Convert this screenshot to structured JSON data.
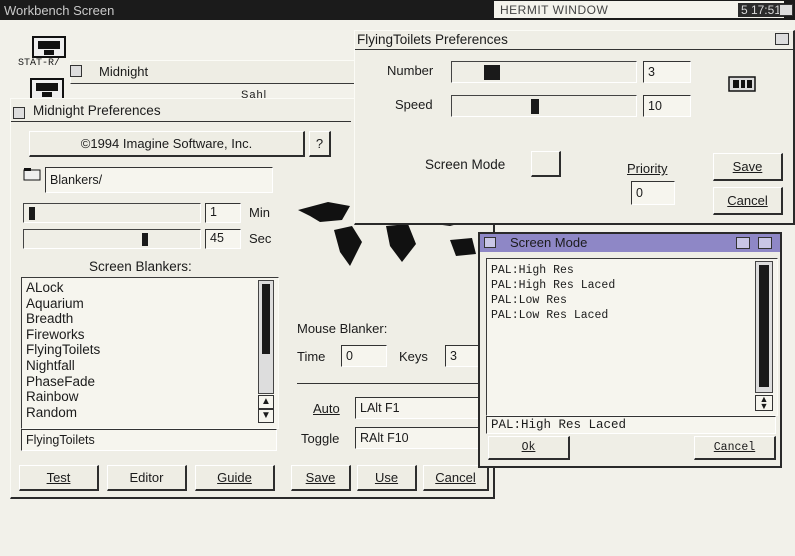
{
  "screen": {
    "title": "Workbench Screen",
    "hermit_title": "HERMIT WINDOW",
    "clock_fragment": "5 17:51"
  },
  "desktop_icons": [
    {
      "label": "STAT-R/"
    },
    {
      "label": "Midnight"
    }
  ],
  "midnight_window": {
    "title": "Midnight",
    "prefs_title": "Midnight Preferences",
    "copyright": "©1994 Imagine Software, Inc.",
    "help_label": "?",
    "blankers_path": "Blankers/",
    "min_value": "1",
    "min_label": "Min",
    "sec_value": "45",
    "sec_label": "Sec",
    "min_level": 0.02,
    "sec_level": 0.7,
    "screen_blankers_label": "Screen Blankers:",
    "blankers": [
      "ALock",
      "Aquarium",
      "Breadth",
      "Fireworks",
      "FlyingToilets",
      "Nightfall",
      "PhaseFade",
      "Rainbow",
      "Random"
    ],
    "selected_blanker": "FlyingToilets",
    "mouse_blanker_label": "Mouse Blanker:",
    "time_label": "Time",
    "time_value": "0",
    "keys_label": "Keys",
    "keys_value": "3",
    "auto_label": "Auto",
    "auto_value": "LAlt F1",
    "toggle_label": "Toggle",
    "toggle_value": "RAlt F10",
    "buttons": {
      "test": "Test",
      "editor": "Editor",
      "guide": "Guide",
      "save": "Save",
      "use": "Use",
      "cancel": "Cancel"
    }
  },
  "flying_toilets_prefs": {
    "title": "FlyingToilets Preferences",
    "number_label": "Number",
    "number_value": "3",
    "number_level": 0.18,
    "speed_label": "Speed",
    "speed_value": "10",
    "speed_level": 0.45,
    "screen_mode_label": "Screen Mode",
    "priority_label": "Priority",
    "priority_value": "0",
    "save_label": "Save",
    "cancel_label": "Cancel"
  },
  "screen_mode_window": {
    "title": "Screen Mode",
    "modes": [
      "PAL:High Res",
      "PAL:High Res Laced",
      "PAL:Low Res",
      "PAL:Low Res Laced"
    ],
    "selected": "PAL:High Res Laced",
    "ok_label": "Ok",
    "cancel_label": "Cancel"
  },
  "colors": {
    "workbench_title_bg": "#1a1a1a",
    "screen_mode_title_bg": "#8e87c6",
    "panel_bg": "#eeede4"
  }
}
